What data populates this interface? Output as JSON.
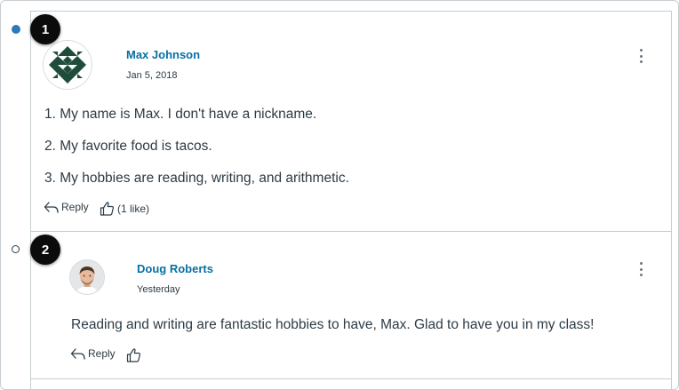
{
  "callouts": [
    "1",
    "2"
  ],
  "entries": [
    {
      "author": "Max Johnson",
      "date": "Jan 5, 2018",
      "paragraphs": [
        "1. My name is Max. I don't have a nickname.",
        "2. My favorite food is tacos.",
        "3. My hobbies are reading, writing, and arithmetic."
      ],
      "reply_label": "Reply",
      "like_label": "(1 like)",
      "unread": true
    },
    {
      "author": "Doug Roberts",
      "date": "Yesterday",
      "paragraphs": [
        "Reading and writing are fantastic hobbies to have, Max. Glad to have you in my class!"
      ],
      "reply_label": "Reply",
      "like_label": "",
      "unread": false
    }
  ],
  "colors": {
    "author_link": "#0770a3",
    "unread_dot": "#2b7abc",
    "text": "#2d3b45"
  }
}
